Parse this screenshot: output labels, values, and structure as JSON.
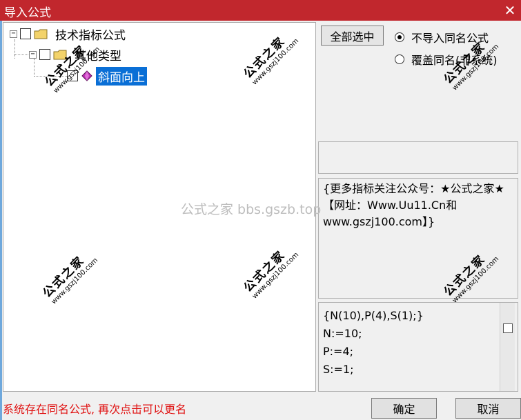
{
  "window": {
    "title": "导入公式",
    "close_glyph": "✕"
  },
  "tree": {
    "root": {
      "label": "技术指标公式",
      "expander": "−"
    },
    "child": {
      "label": "其他类型",
      "expander": "−"
    },
    "leaf": {
      "label": "斜面向上"
    }
  },
  "options": {
    "select_all_label": "全部选中",
    "radio_skip_label": "不导入同名公式",
    "radio_overwrite_label": "覆盖同名(非系统)",
    "selected": "skip"
  },
  "info_text": "{更多指标关注公众号：★公式之家★ 【网址：Www.Uu11.Cn和www.gszj100.com】}",
  "code_lines": [
    "{N(10),P(4),S(1);}",
    "N:=10;",
    "P:=4;",
    "S:=1;"
  ],
  "status_message": "系统存在同名公式, 再次点击可以更名",
  "buttons": {
    "ok_label": "确定",
    "cancel_label": "取消"
  },
  "watermark": {
    "main": "公式之家",
    "url": "www.gszj100.com",
    "center": "公式之家 bbs.gszb.top"
  },
  "colors": {
    "title_bar": "#c1272d",
    "selection": "#0a6fd6",
    "status": "#e01010"
  }
}
